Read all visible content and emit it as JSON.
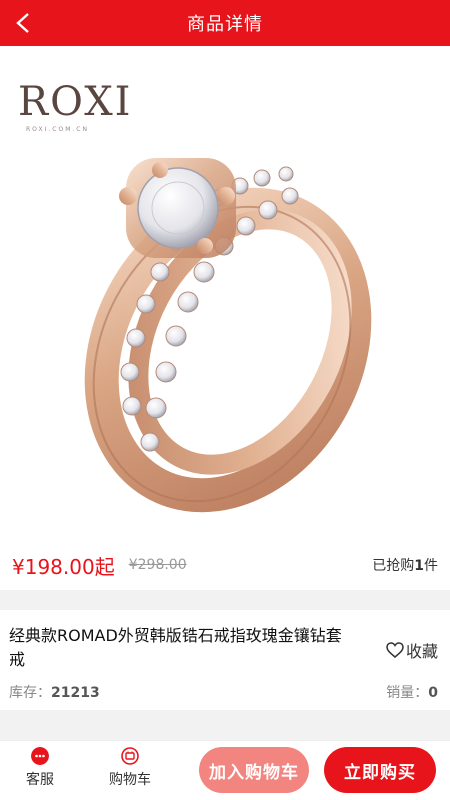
{
  "header": {
    "title": "商品详情"
  },
  "brand": {
    "logo": "ROXI",
    "site": "ROXI.COM.CN"
  },
  "price": {
    "current": "¥198.00起",
    "original": "¥298.00",
    "sold_prefix": "已抢购",
    "sold_count": "1",
    "sold_suffix": "件"
  },
  "product": {
    "name": "经典款ROMAD外贸韩版锆石戒指玫瑰金镶钻套戒",
    "favorite_label": "收藏",
    "stock_label": "库存：",
    "stock_value": "21213",
    "sales_label": "销量：",
    "sales_value": "0"
  },
  "bottom_bar": {
    "service_label": "客服",
    "cart_label": "购物车",
    "add_to_cart": "加入购物车",
    "buy_now": "立即购买"
  },
  "colors": {
    "brand_red": "#e8141b",
    "light_red": "#f2857f"
  }
}
